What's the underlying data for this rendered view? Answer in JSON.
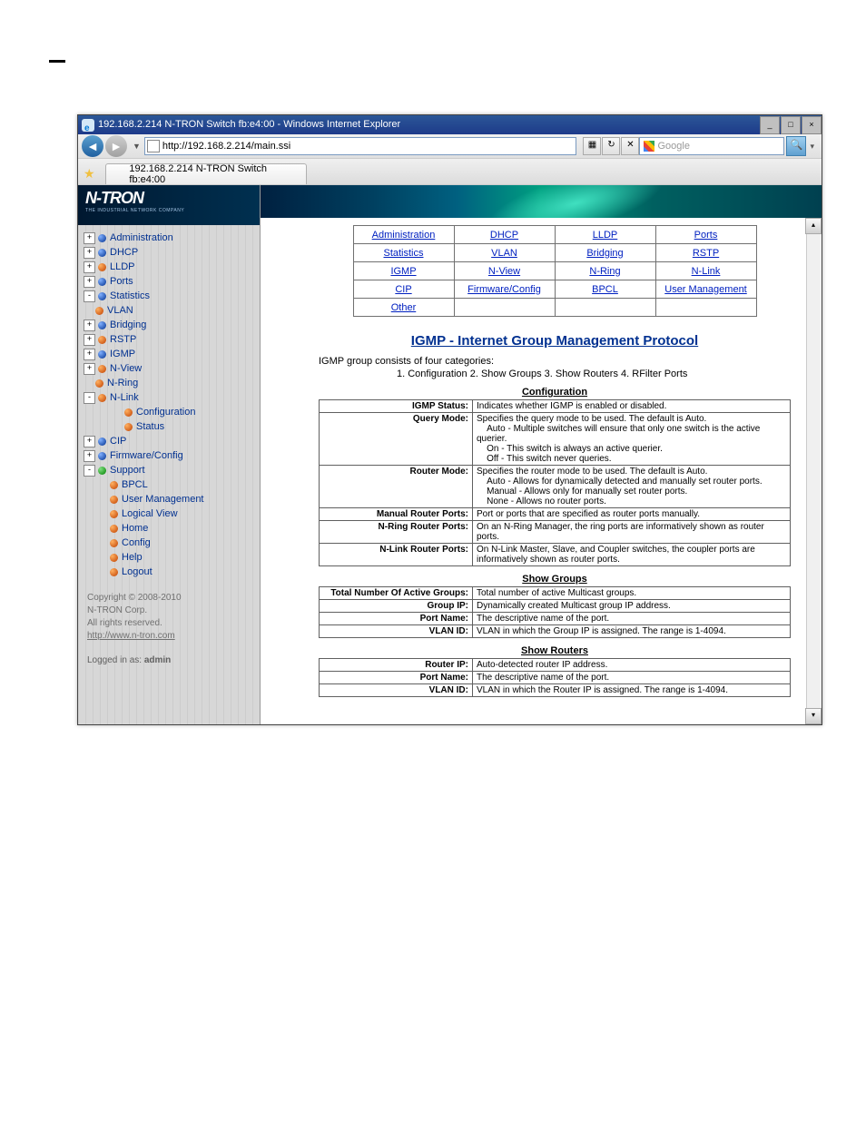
{
  "window": {
    "title": "192.168.2.214 N-TRON Switch fb:e4:00 - Windows Internet Explorer",
    "min": "_",
    "max": "□",
    "close": "×"
  },
  "nav": {
    "url": "http://192.168.2.214/main.ssi",
    "refresh": "↻",
    "stop": "✕",
    "search_placeholder": "Google",
    "search_go": "🔍"
  },
  "tab": {
    "label": "192.168.2.214 N-TRON Switch fb:e4:00"
  },
  "logo": {
    "brand": "N-TRON",
    "tag": "THE INDUSTRIAL NETWORK COMPANY"
  },
  "tree": [
    {
      "exp": "+",
      "dot": "blue",
      "label": "Administration",
      "i": 0
    },
    {
      "exp": "+",
      "dot": "blue",
      "label": "DHCP",
      "i": 0
    },
    {
      "exp": "+",
      "dot": "orange",
      "label": "LLDP",
      "i": 0
    },
    {
      "exp": "+",
      "dot": "blue",
      "label": "Ports",
      "i": 0
    },
    {
      "exp": "-",
      "dot": "blue",
      "label": "Statistics",
      "i": 0
    },
    {
      "exp": "",
      "dot": "orange",
      "label": "VLAN",
      "i": 0
    },
    {
      "exp": "+",
      "dot": "blue",
      "label": "Bridging",
      "i": 0
    },
    {
      "exp": "+",
      "dot": "orange",
      "label": "RSTP",
      "i": 0
    },
    {
      "exp": "+",
      "dot": "blue",
      "label": "IGMP",
      "i": 0
    },
    {
      "exp": "+",
      "dot": "orange",
      "label": "N-View",
      "i": 0
    },
    {
      "exp": "",
      "dot": "orange",
      "label": "N-Ring",
      "i": 0
    },
    {
      "exp": "-",
      "dot": "orange",
      "label": "N-Link",
      "i": 0
    },
    {
      "exp": "",
      "dot": "orange",
      "label": "Configuration",
      "i": 2
    },
    {
      "exp": "",
      "dot": "orange",
      "label": "Status",
      "i": 2
    },
    {
      "exp": "+",
      "dot": "blue",
      "label": "CIP",
      "i": 0
    },
    {
      "exp": "+",
      "dot": "blue",
      "label": "Firmware/Config",
      "i": 0
    },
    {
      "exp": "-",
      "dot": "green",
      "label": "Support",
      "i": 0
    },
    {
      "exp": "",
      "dot": "orange",
      "label": "BPCL",
      "i": 1
    },
    {
      "exp": "",
      "dot": "orange",
      "label": "User Management",
      "i": 1
    },
    {
      "exp": "",
      "dot": "orange",
      "label": "Logical View",
      "i": 1
    },
    {
      "exp": "",
      "dot": "orange",
      "label": "Home",
      "i": 1
    },
    {
      "exp": "",
      "dot": "orange",
      "label": "Config",
      "i": 1
    },
    {
      "exp": "",
      "dot": "orange",
      "label": "Help",
      "i": 1
    },
    {
      "exp": "",
      "dot": "orange",
      "label": "Logout",
      "i": 1
    }
  ],
  "footer": {
    "copyright": "Copyright © 2008-2010",
    "company": "N-TRON Corp.",
    "rights": "All rights reserved.",
    "url": "http://www.n-tron.com"
  },
  "login": {
    "prefix": "Logged in as: ",
    "user": "admin"
  },
  "grid": [
    [
      "Administration",
      "DHCP",
      "LLDP",
      "Ports"
    ],
    [
      "Statistics",
      "VLAN",
      "Bridging",
      "RSTP"
    ],
    [
      "IGMP",
      "N-View",
      "N-Ring",
      "N-Link"
    ],
    [
      "CIP",
      "Firmware/Config",
      "BPCL",
      "User Management"
    ],
    [
      "Other",
      "",
      "",
      ""
    ]
  ],
  "page": {
    "title": "IGMP - Internet Group Management Protocol",
    "intro": "IGMP group consists of four categories:",
    "cats": "1. Configuration   2. Show Groups   3. Show Routers   4. RFilter Ports"
  },
  "sections": {
    "config": {
      "title": "Configuration",
      "rows": [
        {
          "k": "IGMP Status:",
          "v": "Indicates whether IGMP is enabled or disabled."
        },
        {
          "k": "Query Mode:",
          "v": "Specifies the query mode to be used. The default is Auto.<br>&nbsp;&nbsp;&nbsp;&nbsp;Auto - Multiple switches will ensure that only one switch is the active querier.<br>&nbsp;&nbsp;&nbsp;&nbsp;On - This switch is always an active querier.<br>&nbsp;&nbsp;&nbsp;&nbsp;Off - This switch never queries."
        },
        {
          "k": "Router Mode:",
          "v": "Specifies the router mode to be used. The default is Auto.<br>&nbsp;&nbsp;&nbsp;&nbsp;Auto - Allows for dynamically detected and manually set router ports.<br>&nbsp;&nbsp;&nbsp;&nbsp;Manual - Allows only for manually set router ports.<br>&nbsp;&nbsp;&nbsp;&nbsp;None - Allows no router ports."
        },
        {
          "k": "Manual Router Ports:",
          "v": "Port or ports that are specified as router ports manually."
        },
        {
          "k": "N-Ring Router Ports:",
          "v": "On an N-Ring Manager, the ring ports are informatively shown as router ports."
        },
        {
          "k": "N-Link Router Ports:",
          "v": "On N-Link Master, Slave, and Coupler switches, the coupler ports are informatively shown as router ports."
        }
      ]
    },
    "groups": {
      "title": "Show Groups",
      "rows": [
        {
          "k": "Total Number Of Active Groups:",
          "v": "Total number of active Multicast groups."
        },
        {
          "k": "Group IP:",
          "v": "Dynamically created Multicast group IP address."
        },
        {
          "k": "Port Name:",
          "v": "The descriptive name of the port."
        },
        {
          "k": "VLAN ID:",
          "v": "VLAN in which the Group IP is assigned. The range is 1-4094."
        }
      ]
    },
    "routers": {
      "title": "Show Routers",
      "rows": [
        {
          "k": "Router IP:",
          "v": "Auto-detected router IP address."
        },
        {
          "k": "Port Name:",
          "v": "The descriptive name of the port."
        },
        {
          "k": "VLAN ID:",
          "v": "VLAN in which the Router IP is assigned. The range is 1-4094."
        }
      ]
    }
  }
}
